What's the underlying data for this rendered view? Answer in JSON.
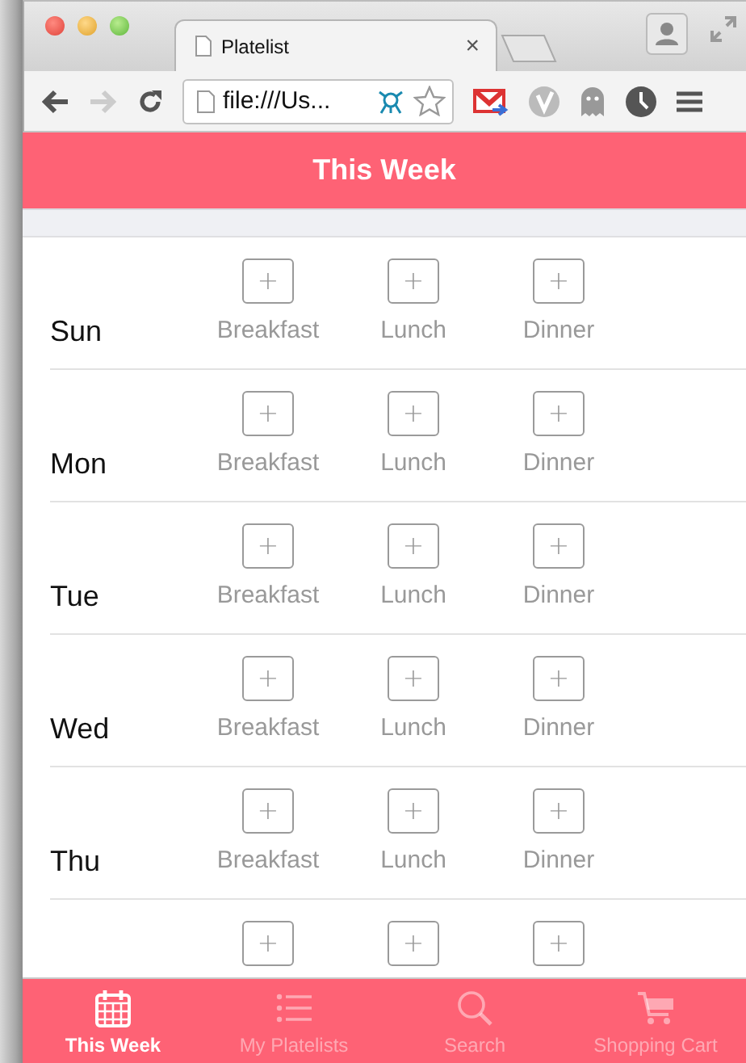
{
  "browser": {
    "tab_title": "Platelist",
    "tab_close": "×",
    "address": "file:///Us..."
  },
  "header": {
    "title": "This Week"
  },
  "days": [
    {
      "name": "Sun",
      "meals": [
        {
          "button": "+",
          "label": "Breakfast"
        },
        {
          "button": "+",
          "label": "Lunch"
        },
        {
          "button": "+",
          "label": "Dinner"
        }
      ]
    },
    {
      "name": "Mon",
      "meals": [
        {
          "button": "+",
          "label": "Breakfast"
        },
        {
          "button": "+",
          "label": "Lunch"
        },
        {
          "button": "+",
          "label": "Dinner"
        }
      ]
    },
    {
      "name": "Tue",
      "meals": [
        {
          "button": "+",
          "label": "Breakfast"
        },
        {
          "button": "+",
          "label": "Lunch"
        },
        {
          "button": "+",
          "label": "Dinner"
        }
      ]
    },
    {
      "name": "Wed",
      "meals": [
        {
          "button": "+",
          "label": "Breakfast"
        },
        {
          "button": "+",
          "label": "Lunch"
        },
        {
          "button": "+",
          "label": "Dinner"
        }
      ]
    },
    {
      "name": "Thu",
      "meals": [
        {
          "button": "+",
          "label": "Breakfast"
        },
        {
          "button": "+",
          "label": "Lunch"
        },
        {
          "button": "+",
          "label": "Dinner"
        }
      ]
    },
    {
      "meals": [
        {
          "button": "+"
        },
        {
          "button": "+"
        },
        {
          "button": "+"
        }
      ]
    }
  ],
  "tab_bar": [
    {
      "label": "This Week",
      "kind": "calendar",
      "selected": true
    },
    {
      "label": "My Platelists",
      "kind": "list",
      "selected": false
    },
    {
      "label": "Search",
      "kind": "search",
      "selected": false
    },
    {
      "label": "Shopping Cart",
      "kind": "cart",
      "selected": false
    }
  ]
}
